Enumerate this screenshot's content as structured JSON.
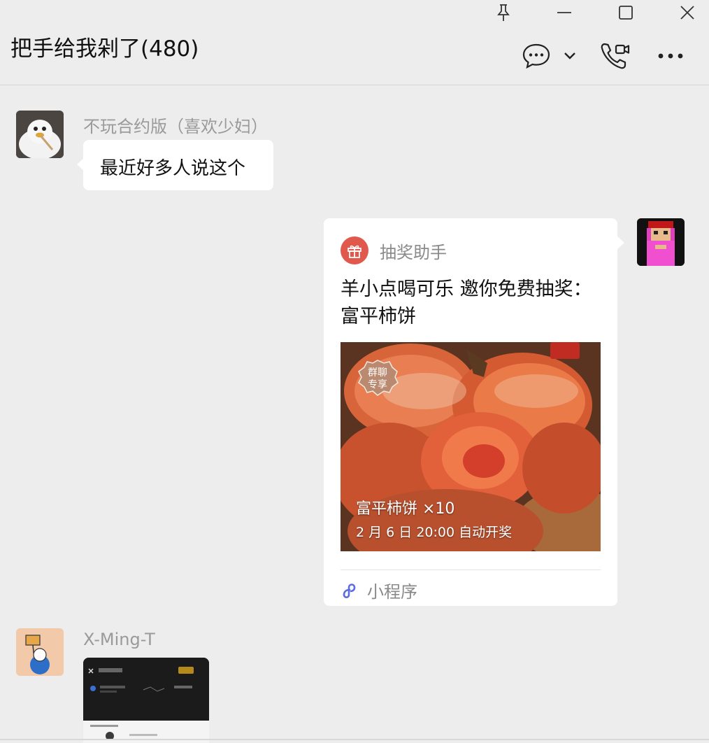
{
  "window": {
    "pin_icon": "pin-icon",
    "minimize_icon": "minimize-icon",
    "maximize_icon": "maximize-icon",
    "close_icon": "close-icon"
  },
  "header": {
    "title": "把手给我剁了(480)",
    "chat_icon": "chat-bubble-icon",
    "dropdown_icon": "chevron-down-icon",
    "call_icon": "video-call-icon",
    "more_icon": "more-icon"
  },
  "messages": [
    {
      "sender": "不玩合约版（喜欢少妇）",
      "text": "最近好多人说这个",
      "side": "left"
    },
    {
      "side": "right",
      "card": {
        "app_name": "抽奖助手",
        "title": "羊小点喝可乐 邀你免费抽奖：富平柿饼",
        "image_badge": "群聊专享",
        "prize": "富平柿饼 ×10",
        "draw_time": "2 月 6 日 20:00 自动开奖",
        "footer_label": "小程序"
      }
    },
    {
      "sender": "X-Ming-T",
      "side": "left",
      "image": {
        "description_icon": "screenshot-thumbnail"
      }
    }
  ],
  "colors": {
    "background": "#ededed",
    "bubble": "#ffffff",
    "gift_accent": "#e0594c",
    "mini_program_accent": "#5b6be0",
    "muted_text": "#9a9a9a"
  }
}
